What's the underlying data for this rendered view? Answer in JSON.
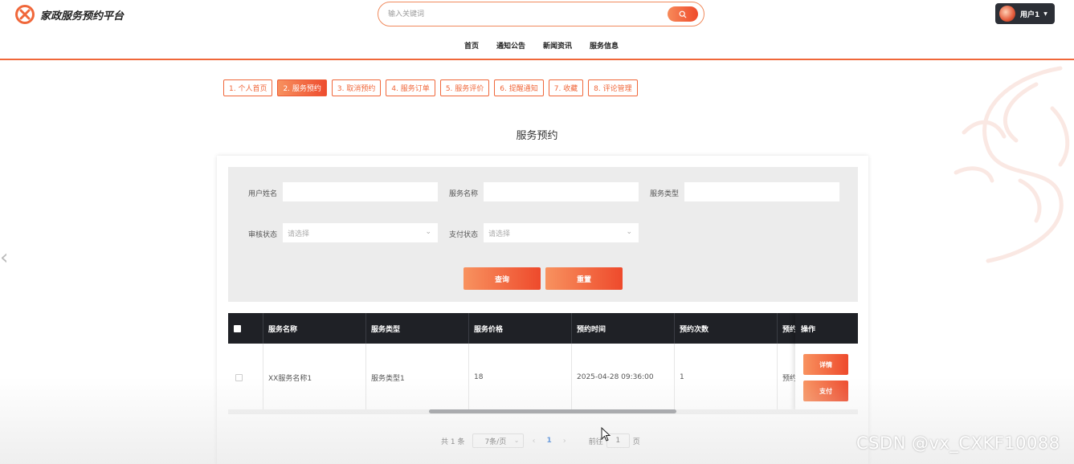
{
  "header": {
    "app_title": "家政服务预约平台",
    "search_placeholder": "输入关键词",
    "user_label": "用户1"
  },
  "nav": {
    "items": [
      "首页",
      "通知公告",
      "新闻资讯",
      "服务信息"
    ]
  },
  "tabs": {
    "items": [
      "1. 个人首页",
      "2. 服务预约",
      "3. 取消预约",
      "4. 服务订单",
      "5. 服务评价",
      "6. 提醒通知",
      "7. 收藏",
      "8. 评论管理"
    ],
    "active_index": 1
  },
  "page_title": "服务预约",
  "filters": {
    "user_name_label": "用户姓名",
    "service_name_label": "服务名称",
    "service_type_label": "服务类型",
    "review_status_label": "审核状态",
    "review_status_placeholder": "请选择",
    "pay_status_label": "支付状态",
    "pay_status_placeholder": "请选择",
    "query_button": "查询",
    "reset_button": "重置"
  },
  "table": {
    "columns": [
      "服务名称",
      "服务类型",
      "服务价格",
      "预约时间",
      "预约次数",
      "预约"
    ],
    "operation_header": "操作",
    "rows": [
      {
        "service_name": "XX服务名称1",
        "service_type": "服务类型1",
        "price": "18",
        "time": "2025-04-28 09:36:00",
        "count": "1",
        "extra": "预约"
      }
    ],
    "detail_button": "详情",
    "pay_button": "支付"
  },
  "pagination": {
    "total": "共 1 条",
    "page_size": "7条/页",
    "current_page": "1",
    "goto_prefix": "前往",
    "goto_value": "1",
    "goto_suffix": "页"
  },
  "watermark": "CSDN @vx_CXKF10088",
  "colors": {
    "accent": "#f0673a",
    "accent_dark": "#ee4a2c",
    "table_header": "#1f2126"
  }
}
